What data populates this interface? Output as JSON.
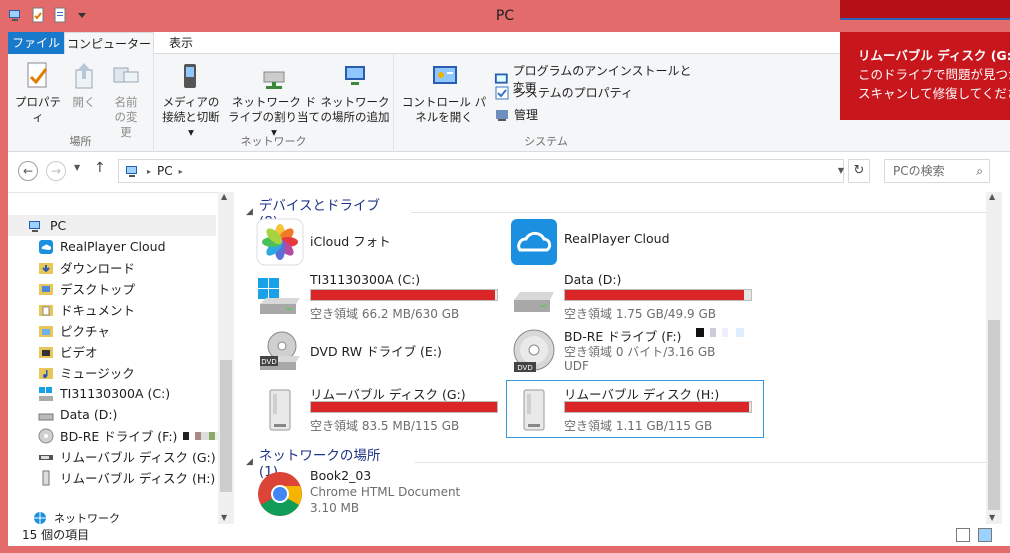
{
  "window": {
    "title": "PC"
  },
  "ribbon": {
    "tabs": [
      {
        "label": "ファイル"
      },
      {
        "label": "コンピューター"
      },
      {
        "label": "表示"
      }
    ],
    "groups": {
      "location": {
        "label": "場所",
        "buttons": [
          {
            "label": "プロパティ"
          },
          {
            "label": "開く"
          },
          {
            "label": "名前の変更"
          }
        ]
      },
      "network": {
        "label": "ネットワーク",
        "buttons": [
          {
            "label": "メディアの接続と切断 ▾"
          },
          {
            "label": "ネットワーク ドライブの割り当て ▾"
          },
          {
            "label": "ネットワークの場所の追加"
          }
        ]
      },
      "system": {
        "label": "システム",
        "control_panel": "コントロール パネルを開く",
        "items": [
          {
            "label": "プログラムのアンインストールと変更"
          },
          {
            "label": "システムのプロパティ"
          },
          {
            "label": "管理"
          }
        ]
      }
    }
  },
  "notification": {
    "title": "リムーバブル ディスク (G:)",
    "line1": "このドライブで問題が見つか",
    "line2": "スキャンして修復してくださ"
  },
  "address": {
    "path": "PC",
    "search_placeholder": "PCの検索"
  },
  "navpane": {
    "items": [
      {
        "label": "PC",
        "icon": "pc-icon"
      },
      {
        "label": "RealPlayer Cloud",
        "icon": "cloud-icon"
      },
      {
        "label": "ダウンロード",
        "icon": "folder-download-icon"
      },
      {
        "label": "デスクトップ",
        "icon": "folder-desktop-icon"
      },
      {
        "label": "ドキュメント",
        "icon": "folder-documents-icon"
      },
      {
        "label": "ピクチャ",
        "icon": "folder-pictures-icon"
      },
      {
        "label": "ビデオ",
        "icon": "folder-videos-icon"
      },
      {
        "label": "ミュージック",
        "icon": "folder-music-icon"
      },
      {
        "label": "TI31130300A (C:)",
        "icon": "windows-drive-icon"
      },
      {
        "label": "Data (D:)",
        "icon": "drive-icon"
      },
      {
        "label": "BD-RE ドライブ (F:)",
        "icon": "disc-drive-icon"
      },
      {
        "label": "リムーバブル ディスク (G:)",
        "icon": "usb-drive-icon"
      },
      {
        "label": "リムーバブル ディスク (H:)",
        "icon": "usb-drive-icon"
      },
      {
        "label": "ネットワーク",
        "icon": "network-icon"
      }
    ]
  },
  "content": {
    "devices_header": "デバイスとドライブ (8)",
    "network_header": "ネットワークの場所 (1)",
    "devices": [
      {
        "name": "iCloud フォト",
        "icon": "icloud-photos-icon"
      },
      {
        "name": "RealPlayer Cloud",
        "icon": "realplayer-cloud-icon"
      },
      {
        "name": "TI31130300A (C:)",
        "free": "空き領域 66.2 MB/630 GB",
        "usage": 0.99,
        "icon": "windows-drive-icon"
      },
      {
        "name": "Data (D:)",
        "free": "空き領域 1.75 GB/49.9 GB",
        "usage": 0.965,
        "icon": "drive-icon"
      },
      {
        "name": "DVD RW ドライブ (E:)",
        "icon": "dvd-drive-icon"
      },
      {
        "name": "BD-RE ドライブ (F:)",
        "free": "空き領域 0 バイト/3.16 GB",
        "fs": "UDF",
        "icon": "dvd-disc-icon"
      },
      {
        "name": "リムーバブル ディスク (G:)",
        "free": "空き領域 83.5 MB/115 GB",
        "usage": 0.999,
        "icon": "usb-drive-icon"
      },
      {
        "name": "リムーバブル ディスク (H:)",
        "free": "空き領域 1.11 GB/115 GB",
        "usage": 0.99,
        "icon": "usb-drive-icon"
      }
    ],
    "network": [
      {
        "name": "Book2_03",
        "type": "Chrome HTML Document",
        "size": "3.10 MB",
        "icon": "chrome-icon"
      }
    ]
  },
  "status": {
    "text": "15 個の項目"
  },
  "colors": {
    "frame": "#e36b6b",
    "accent": "#1979ca",
    "bar_full": "#da2626",
    "toast": "#c8161d"
  }
}
